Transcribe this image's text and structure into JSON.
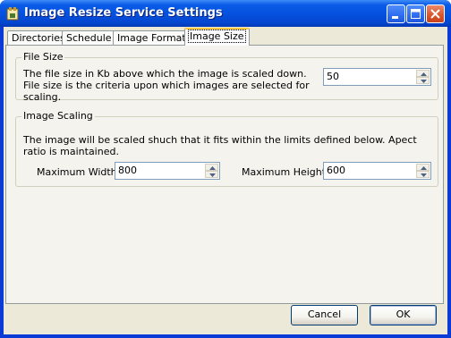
{
  "window": {
    "title": "Image Resize Service Settings"
  },
  "tabs": [
    {
      "label": "Directories"
    },
    {
      "label": "Schedule"
    },
    {
      "label": "Image Formats"
    },
    {
      "label": "Image Size"
    }
  ],
  "file_size": {
    "group_label": "File Size",
    "description": "The file size in Kb above which the image is scaled down. File size is the criteria upon which images are selected for scaling.",
    "value": "50"
  },
  "image_scaling": {
    "group_label": "Image Scaling",
    "description": "The image will be scaled shuch that it fits within the limits defined below. Apect ratio is maintained.",
    "max_width_label": "Maximum Width:",
    "max_width_value": "800",
    "max_height_label": "Maximum Height:",
    "max_height_value": "600"
  },
  "buttons": {
    "cancel": "Cancel",
    "ok": "OK"
  },
  "colors": {
    "titlebar": "#0652e0",
    "dialog_bg": "#ece9d8",
    "active_tab_accent": "#ffc83c"
  }
}
